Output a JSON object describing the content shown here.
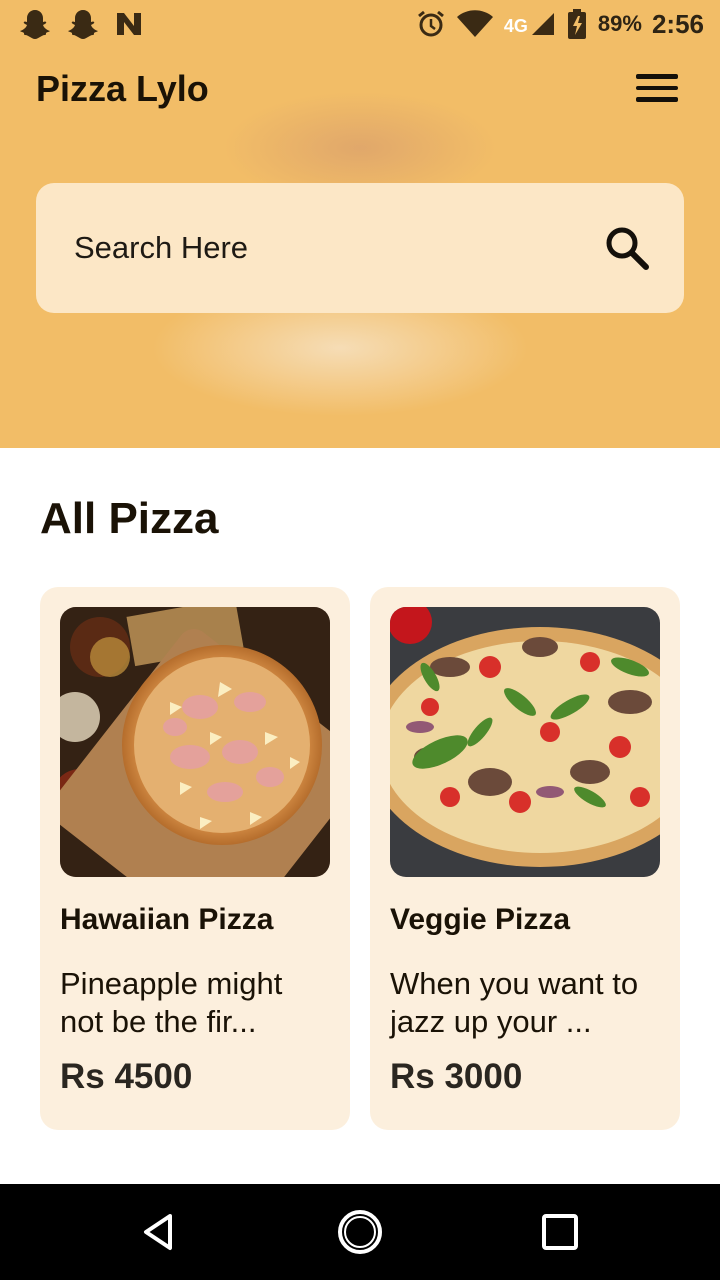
{
  "status_bar": {
    "left_icons": [
      "snapchat-icon",
      "snapchat-icon",
      "n-notification-icon"
    ],
    "right_icons": [
      "alarm-icon",
      "wifi-icon",
      "lte-4g-signal-icon",
      "battery-charging-icon"
    ],
    "network": "4G",
    "battery": "89%",
    "time": "2:56"
  },
  "header": {
    "title": "Pizza Lylo",
    "menu_icon": "hamburger-menu-icon"
  },
  "search": {
    "placeholder": "Search Here",
    "value": "",
    "icon": "search-icon"
  },
  "section": {
    "title": "All Pizza"
  },
  "products": [
    {
      "name": "Hawaiian Pizza",
      "description": "Pineapple might not be the fir...",
      "price": "Rs 4500",
      "image": "hawaiian-pizza-photo"
    },
    {
      "name": "Veggie Pizza",
      "description": "When you want to jazz up your ...",
      "price": "Rs 3000",
      "image": "veggie-pizza-photo"
    }
  ],
  "nav_bar": {
    "buttons": [
      "back-icon",
      "home-icon",
      "recent-apps-icon"
    ]
  },
  "colors": {
    "hero_background": "#f2bd67",
    "search_background": "#fce7c6",
    "card_background": "#fcefdd",
    "text_primary": "#1a1206",
    "nav_background": "#000000"
  }
}
